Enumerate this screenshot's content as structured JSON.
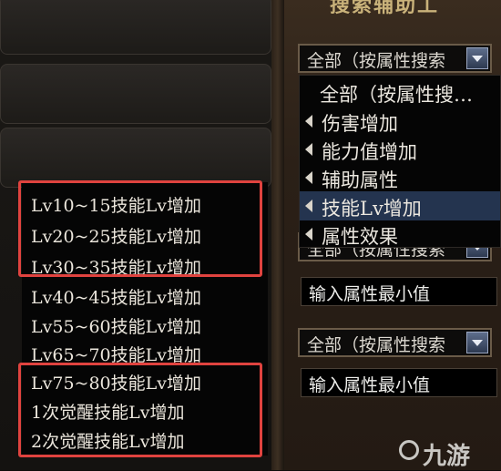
{
  "right_panel": {
    "title": "搜索辅助工"
  },
  "dropdown_top": {
    "value": "全部（按属性搜索"
  },
  "menu": {
    "items": [
      {
        "label": "全部（按属性搜…"
      },
      {
        "label": "伤害增加"
      },
      {
        "label": "能力值增加"
      },
      {
        "label": "辅助属性"
      },
      {
        "label": "技能Lv增加"
      },
      {
        "label": "属性效果"
      }
    ]
  },
  "dropdown_second": {
    "value": "全部（按属性搜索"
  },
  "input_min1": {
    "value": "输入属性最小值"
  },
  "dropdown_third": {
    "value": "全部（按属性搜索"
  },
  "input_min2": {
    "value": "输入属性最小值"
  },
  "skill_list": {
    "items": [
      "Lv10~15技能Lv增加",
      "Lv20~25技能Lv增加",
      "Lv30~35技能Lv增加",
      "Lv40~45技能Lv增加",
      "Lv55~60技能Lv增加",
      "Lv65~70技能Lv增加",
      "Lv75~80技能Lv增加",
      "1次觉醒技能Lv增加",
      "2次觉醒技能Lv增加"
    ]
  },
  "watermark": {
    "text": "九游"
  },
  "colors": {
    "highlight": "#e0433f",
    "selected_row": "#24344f",
    "panel": "#2b2017"
  }
}
